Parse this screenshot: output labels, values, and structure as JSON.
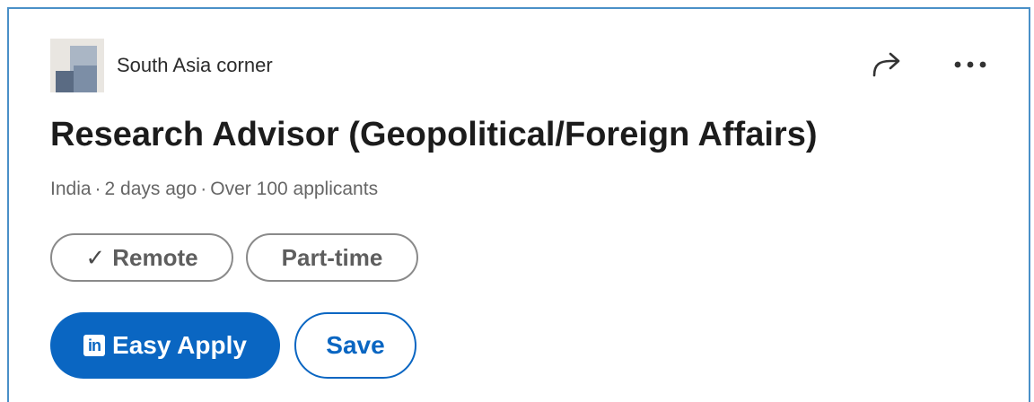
{
  "company": {
    "name": "South Asia corner",
    "logo_icon": "company-logo"
  },
  "header_actions": {
    "share_icon": "share-arrow-icon",
    "more_icon": "more-options-icon"
  },
  "job": {
    "title": "Research Advisor (Geopolitical/Foreign Affairs)",
    "location": "India",
    "posted": "2 days ago",
    "applicants": "Over 100 applicants",
    "separator": "·"
  },
  "chips": {
    "remote_check": "✓",
    "remote_label": "Remote",
    "parttime_label": "Part-time"
  },
  "actions": {
    "apply_icon_text": "in",
    "apply_label": "Easy Apply",
    "save_label": "Save"
  },
  "colors": {
    "brand": "#0a66c2",
    "border": "#4a90c8",
    "chip_border": "#8a8a8a",
    "meta_text": "#666666"
  }
}
